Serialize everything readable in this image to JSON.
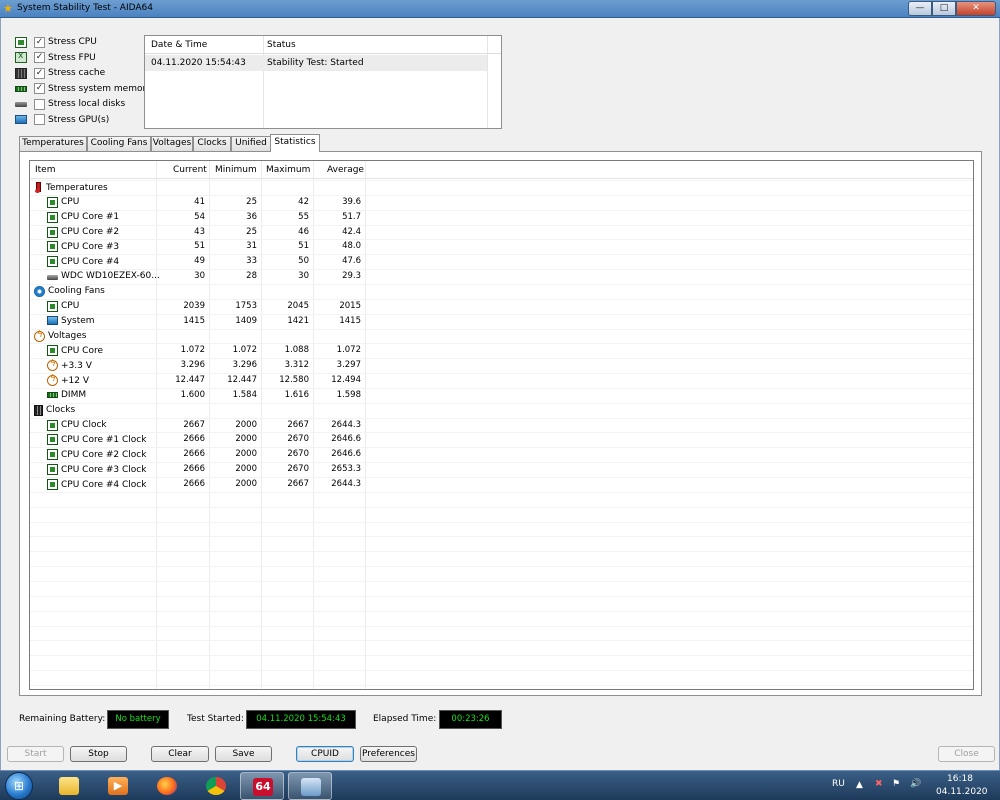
{
  "window": {
    "title": "System Stability Test - AIDA64",
    "controls": {
      "minimize": "—",
      "maximize": "□",
      "close": "✕"
    }
  },
  "stress_options": [
    {
      "label": "Stress CPU",
      "checked": true,
      "icon": "cpu-chip-icon"
    },
    {
      "label": "Stress FPU",
      "checked": true,
      "icon": "fpu-icon"
    },
    {
      "label": "Stress cache",
      "checked": true,
      "icon": "cache-icon"
    },
    {
      "label": "Stress system memory",
      "checked": true,
      "icon": "memory-icon"
    },
    {
      "label": "Stress local disks",
      "checked": false,
      "icon": "disk-icon"
    },
    {
      "label": "Stress GPU(s)",
      "checked": false,
      "icon": "gpu-icon"
    }
  ],
  "status_log": {
    "headers": {
      "datetime": "Date & Time",
      "status": "Status"
    },
    "rows": [
      {
        "datetime": "04.11.2020 15:54:43",
        "status": "Stability Test: Started"
      }
    ]
  },
  "tabs": {
    "labels": [
      "Temperatures",
      "Cooling Fans",
      "Voltages",
      "Clocks",
      "Unified",
      "Statistics"
    ],
    "active": "Statistics"
  },
  "stats": {
    "headers": {
      "item": "Item",
      "current": "Current",
      "minimum": "Minimum",
      "maximum": "Maximum",
      "average": "Average"
    },
    "rows": [
      {
        "type": "group",
        "label": "Temperatures",
        "icon": "thermometer-icon"
      },
      {
        "type": "item",
        "label": "CPU",
        "icon": "chip-icon",
        "current": "41",
        "minimum": "25",
        "maximum": "42",
        "average": "39.6"
      },
      {
        "type": "item",
        "label": "CPU Core #1",
        "icon": "chip-icon",
        "current": "54",
        "minimum": "36",
        "maximum": "55",
        "average": "51.7"
      },
      {
        "type": "item",
        "label": "CPU Core #2",
        "icon": "chip-icon",
        "current": "43",
        "minimum": "25",
        "maximum": "46",
        "average": "42.4"
      },
      {
        "type": "item",
        "label": "CPU Core #3",
        "icon": "chip-icon",
        "current": "51",
        "minimum": "31",
        "maximum": "51",
        "average": "48.0"
      },
      {
        "type": "item",
        "label": "CPU Core #4",
        "icon": "chip-icon",
        "current": "49",
        "minimum": "33",
        "maximum": "50",
        "average": "47.6"
      },
      {
        "type": "item",
        "label": "WDC WD10EZEX-60...",
        "icon": "hdd-icon",
        "current": "30",
        "minimum": "28",
        "maximum": "30",
        "average": "29.3"
      },
      {
        "type": "group",
        "label": "Cooling Fans",
        "icon": "fan-icon"
      },
      {
        "type": "item",
        "label": "CPU",
        "icon": "chip-icon",
        "current": "2039",
        "minimum": "1753",
        "maximum": "2045",
        "average": "2015"
      },
      {
        "type": "item",
        "label": "System",
        "icon": "monitor-icon",
        "current": "1415",
        "minimum": "1409",
        "maximum": "1421",
        "average": "1415"
      },
      {
        "type": "group",
        "label": "Voltages",
        "icon": "voltage-icon"
      },
      {
        "type": "item",
        "label": "CPU Core",
        "icon": "chip-icon",
        "current": "1.072",
        "minimum": "1.072",
        "maximum": "1.088",
        "average": "1.072"
      },
      {
        "type": "item",
        "label": "+3.3 V",
        "icon": "voltage-icon",
        "current": "3.296",
        "minimum": "3.296",
        "maximum": "3.312",
        "average": "3.297"
      },
      {
        "type": "item",
        "label": "+12 V",
        "icon": "voltage-icon",
        "current": "12.447",
        "minimum": "12.447",
        "maximum": "12.580",
        "average": "12.494"
      },
      {
        "type": "item",
        "label": "DIMM",
        "icon": "dimm-icon",
        "current": "1.600",
        "minimum": "1.584",
        "maximum": "1.616",
        "average": "1.598"
      },
      {
        "type": "group",
        "label": "Clocks",
        "icon": "clock-chip-icon"
      },
      {
        "type": "item",
        "label": "CPU Clock",
        "icon": "chip-icon",
        "current": "2667",
        "minimum": "2000",
        "maximum": "2667",
        "average": "2644.3"
      },
      {
        "type": "item",
        "label": "CPU Core #1 Clock",
        "icon": "chip-icon",
        "current": "2666",
        "minimum": "2000",
        "maximum": "2670",
        "average": "2646.6"
      },
      {
        "type": "item",
        "label": "CPU Core #2 Clock",
        "icon": "chip-icon",
        "current": "2666",
        "minimum": "2000",
        "maximum": "2670",
        "average": "2646.6"
      },
      {
        "type": "item",
        "label": "CPU Core #3 Clock",
        "icon": "chip-icon",
        "current": "2666",
        "minimum": "2000",
        "maximum": "2670",
        "average": "2653.3"
      },
      {
        "type": "item",
        "label": "CPU Core #4 Clock",
        "icon": "chip-icon",
        "current": "2666",
        "minimum": "2000",
        "maximum": "2667",
        "average": "2644.3"
      }
    ]
  },
  "bottom_info": {
    "battery_label": "Remaining Battery:",
    "battery_value": "No battery",
    "started_label": "Test Started:",
    "started_value": "04.11.2020 15:54:43",
    "elapsed_label": "Elapsed Time:",
    "elapsed_value": "00:23:26",
    "value_color": "#16e016"
  },
  "buttons": {
    "start": "Start",
    "stop": "Stop",
    "clear": "Clear",
    "save": "Save",
    "cpuid": "CPUID",
    "preferences": "Preferences",
    "close": "Close"
  },
  "taskbar": {
    "apps": [
      "explorer-icon",
      "media-player-icon",
      "firefox-icon",
      "chrome-icon",
      "aida64-icon",
      "window-app-icon"
    ],
    "aida_label": "64",
    "language": "RU",
    "time": "16:18",
    "date": "04.11.2020"
  }
}
